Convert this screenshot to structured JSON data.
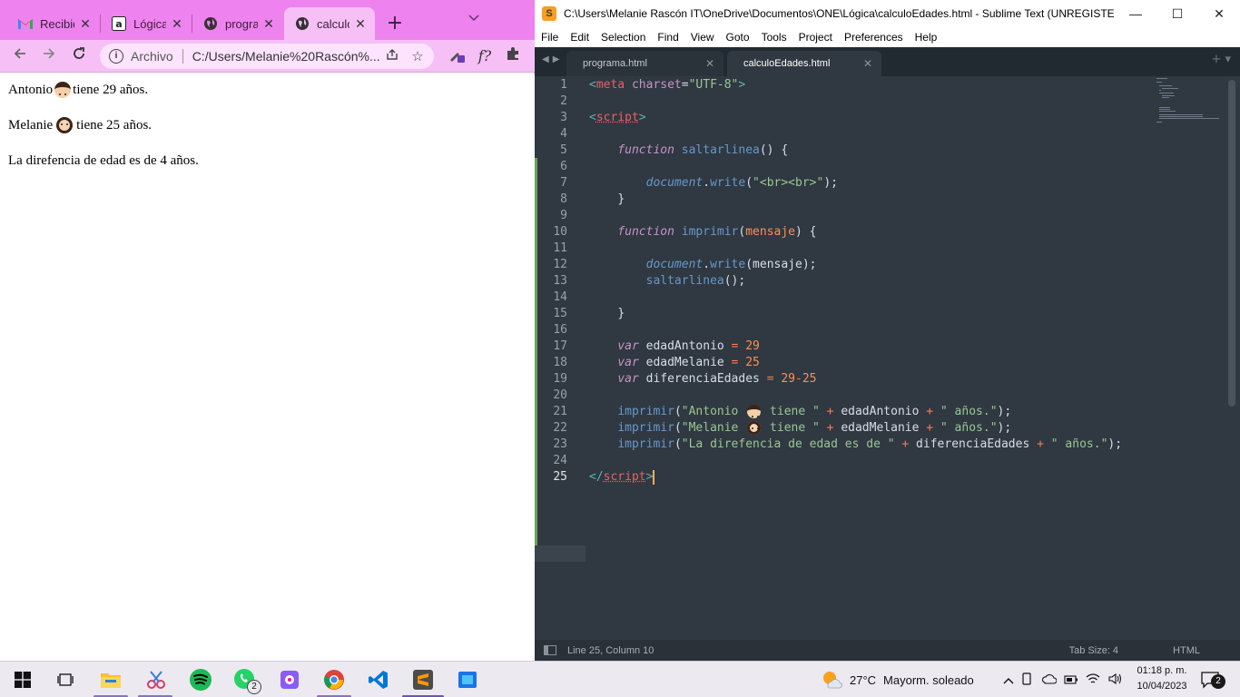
{
  "chrome": {
    "tabs": [
      {
        "title": "Recibid",
        "close": "✕"
      },
      {
        "title": "Lógica",
        "close": "✕"
      },
      {
        "title": "progra",
        "close": "✕"
      },
      {
        "title": "calculo",
        "close": "✕"
      }
    ],
    "new_tab": "+",
    "omnibox": {
      "scheme_label": "Archivo",
      "url": "C:/Users/Melanie%20Rascón%..."
    },
    "page": {
      "lines": [
        {
          "before": "Antonio",
          "after": "tiene 29 años."
        },
        {
          "before": "Melanie",
          "after": "tiene 25 años."
        },
        {
          "text": "La direfencia de edad es de 4 años."
        }
      ]
    }
  },
  "sublime": {
    "title": "C:\\Users\\Melanie Rascón IT\\OneDrive\\Documentos\\ONE\\Lógica\\calculoEdades.html - Sublime Text (UNREGISTER...",
    "menu": [
      "File",
      "Edit",
      "Selection",
      "Find",
      "View",
      "Goto",
      "Tools",
      "Project",
      "Preferences",
      "Help"
    ],
    "tabs": [
      {
        "label": "programa.html",
        "active": false
      },
      {
        "label": "calculoEdades.html",
        "active": true
      }
    ],
    "line_numbers": [
      "1",
      "2",
      "3",
      "4",
      "5",
      "6",
      "7",
      "8",
      "9",
      "10",
      "11",
      "12",
      "13",
      "14",
      "15",
      "16",
      "17",
      "18",
      "19",
      "20",
      "21",
      "22",
      "23",
      "24",
      "25"
    ],
    "current_line": 25,
    "status": {
      "position": "Line 25, Column 10",
      "tab_size": "Tab Size: 4",
      "syntax": "HTML"
    }
  },
  "taskbar": {
    "weather": {
      "temp": "27°C",
      "text": "Mayorm. soleado"
    },
    "clock": {
      "time": "01:18 p. m.",
      "date": "10/04/2023"
    },
    "whatsapp_badge": "2",
    "notifications_badge": "2"
  },
  "colors": {
    "chrome_tabstrip": "#ee82ee",
    "chrome_toolbar": "#f6c0f6",
    "sublime_bg": "#303841",
    "keyword": "#c594c5",
    "string": "#99c794",
    "number": "#f99157",
    "function": "#6699cc"
  }
}
